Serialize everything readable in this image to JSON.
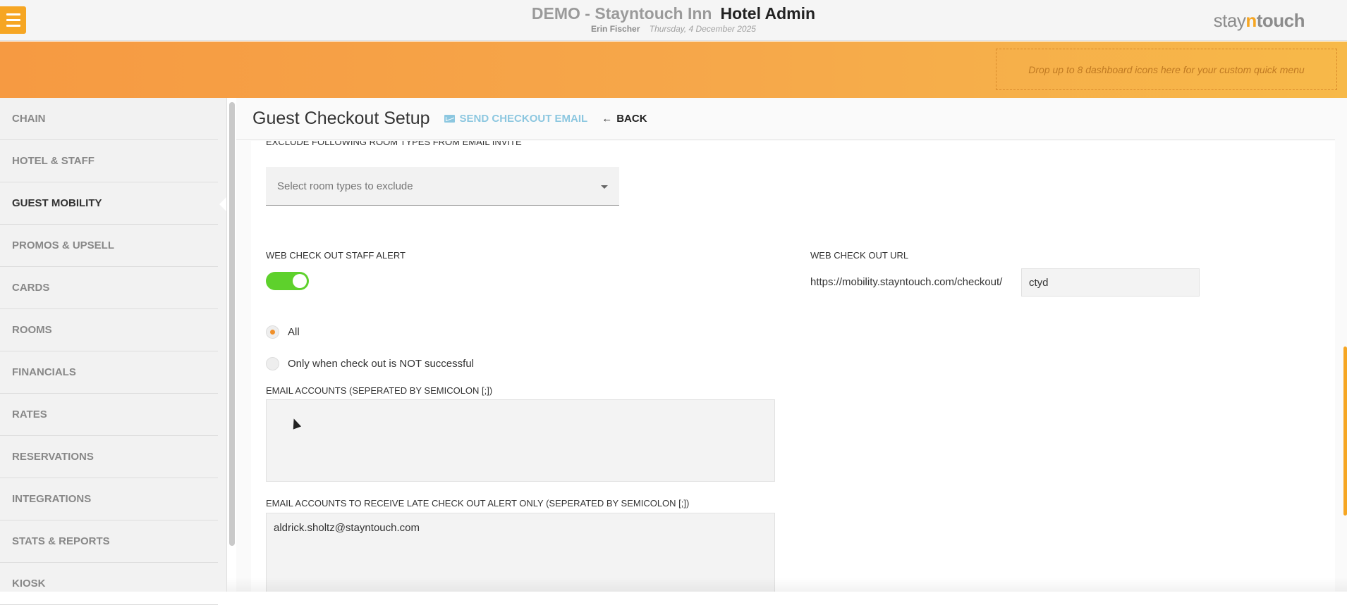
{
  "header": {
    "hotel_name": "DEMO - Stayntouch Inn",
    "section": "Hotel Admin",
    "user": "Erin Fischer",
    "date": "Thursday, 4 December 2025",
    "logo_prefix": "stay",
    "logo_n": "n",
    "logo_suffix": "touch"
  },
  "band": {
    "dropzone_text": "Drop up to 8 dashboard icons here for your custom quick menu"
  },
  "sidebar": {
    "items": [
      {
        "label": "CHAIN"
      },
      {
        "label": "HOTEL & STAFF"
      },
      {
        "label": "GUEST MOBILITY"
      },
      {
        "label": "PROMOS & UPSELL"
      },
      {
        "label": "CARDS"
      },
      {
        "label": "ROOMS"
      },
      {
        "label": "FINANCIALS"
      },
      {
        "label": "RATES"
      },
      {
        "label": "RESERVATIONS"
      },
      {
        "label": "INTEGRATIONS"
      },
      {
        "label": "STATS & REPORTS"
      },
      {
        "label": "KIOSK"
      }
    ],
    "active": "GUEST MOBILITY"
  },
  "page": {
    "title": "Guest Checkout Setup",
    "send_email_label": "SEND CHECKOUT EMAIL",
    "back_label": "BACK",
    "back_icon": "arrow-left-icon"
  },
  "form": {
    "exclude_label": "EXCLUDE FOLLOWING ROOM TYPES FROM EMAIL INVITE",
    "exclude_placeholder": "Select room types to exclude",
    "staff_alert_label": "WEB CHECK OUT STAFF ALERT",
    "staff_alert_on": true,
    "radio_all": "All",
    "radio_not_successful": "Only when check out is NOT successful",
    "radio_selected": "All",
    "email_accounts_label": "EMAIL ACCOUNTS (SEPERATED BY SEMICOLON [;])",
    "email_accounts_value": "",
    "late_email_label": "EMAIL ACCOUNTS TO RECEIVE LATE CHECK OUT ALERT ONLY (SEPERATED BY SEMICOLON [;])",
    "late_email_value": "aldrick.sholtz@stayntouch.com",
    "url_label": "WEB CHECK OUT URL",
    "url_prefix": "https://mobility.stayntouch.com/checkout/",
    "url_value": "ctyd"
  },
  "colors": {
    "accent": "#f6a623",
    "toggle_on": "#5ed12c",
    "link": "#8cc7e0"
  }
}
